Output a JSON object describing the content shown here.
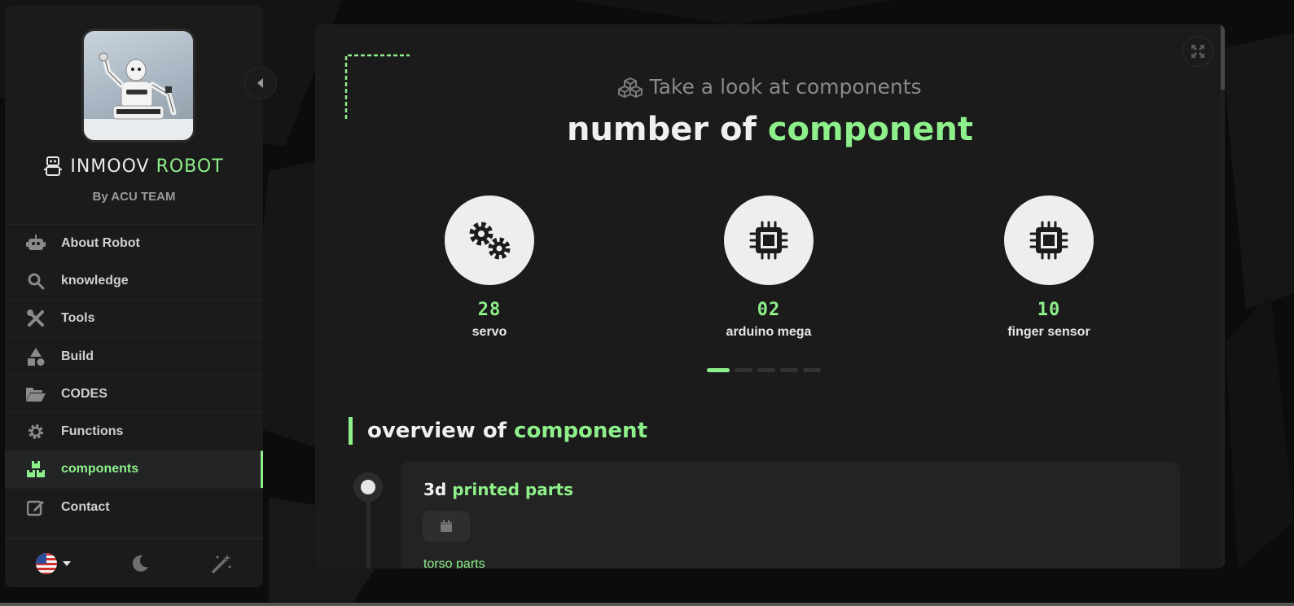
{
  "colors": {
    "accent": "#8ef08a",
    "panel": "#1b1b1b",
    "page_bg": "#0c0c0c"
  },
  "sidebar": {
    "brand_part1": "INMOOV",
    "brand_part2": "ROBOT",
    "byline": "By ACU TEAM",
    "items": [
      {
        "label": "About Robot",
        "icon": "robot-icon"
      },
      {
        "label": "knowledge",
        "icon": "search-icon"
      },
      {
        "label": "Tools",
        "icon": "tools-icon"
      },
      {
        "label": "Build",
        "icon": "shapes-icon"
      },
      {
        "label": "CODES",
        "icon": "folder-open-icon"
      },
      {
        "label": "Functions",
        "icon": "gear-icon"
      },
      {
        "label": "components",
        "icon": "boxes-icon",
        "active": true
      },
      {
        "label": "Contact",
        "icon": "edit-icon"
      }
    ],
    "footer": {
      "language": "us-flag-icon",
      "theme": "moon-icon",
      "effects": "magic-wand-icon"
    }
  },
  "main": {
    "kicker": "Take a look at components",
    "headline_part1": "number of",
    "headline_part2": "component",
    "stats": [
      {
        "value": "28",
        "label": "servo",
        "icon": "gears-icon"
      },
      {
        "value": "02",
        "label": "arduino mega",
        "icon": "microchip-icon"
      },
      {
        "value": "10",
        "label": "finger sensor",
        "icon": "microchip-icon"
      }
    ],
    "carousel_active_index": 0,
    "carousel_count": 5,
    "section_title_part1": "overview of",
    "section_title_part2": "component",
    "card": {
      "title_part1": "3d",
      "title_part2": "printed parts",
      "tag_icon": "calendar-icon",
      "link": "torso parts"
    }
  }
}
